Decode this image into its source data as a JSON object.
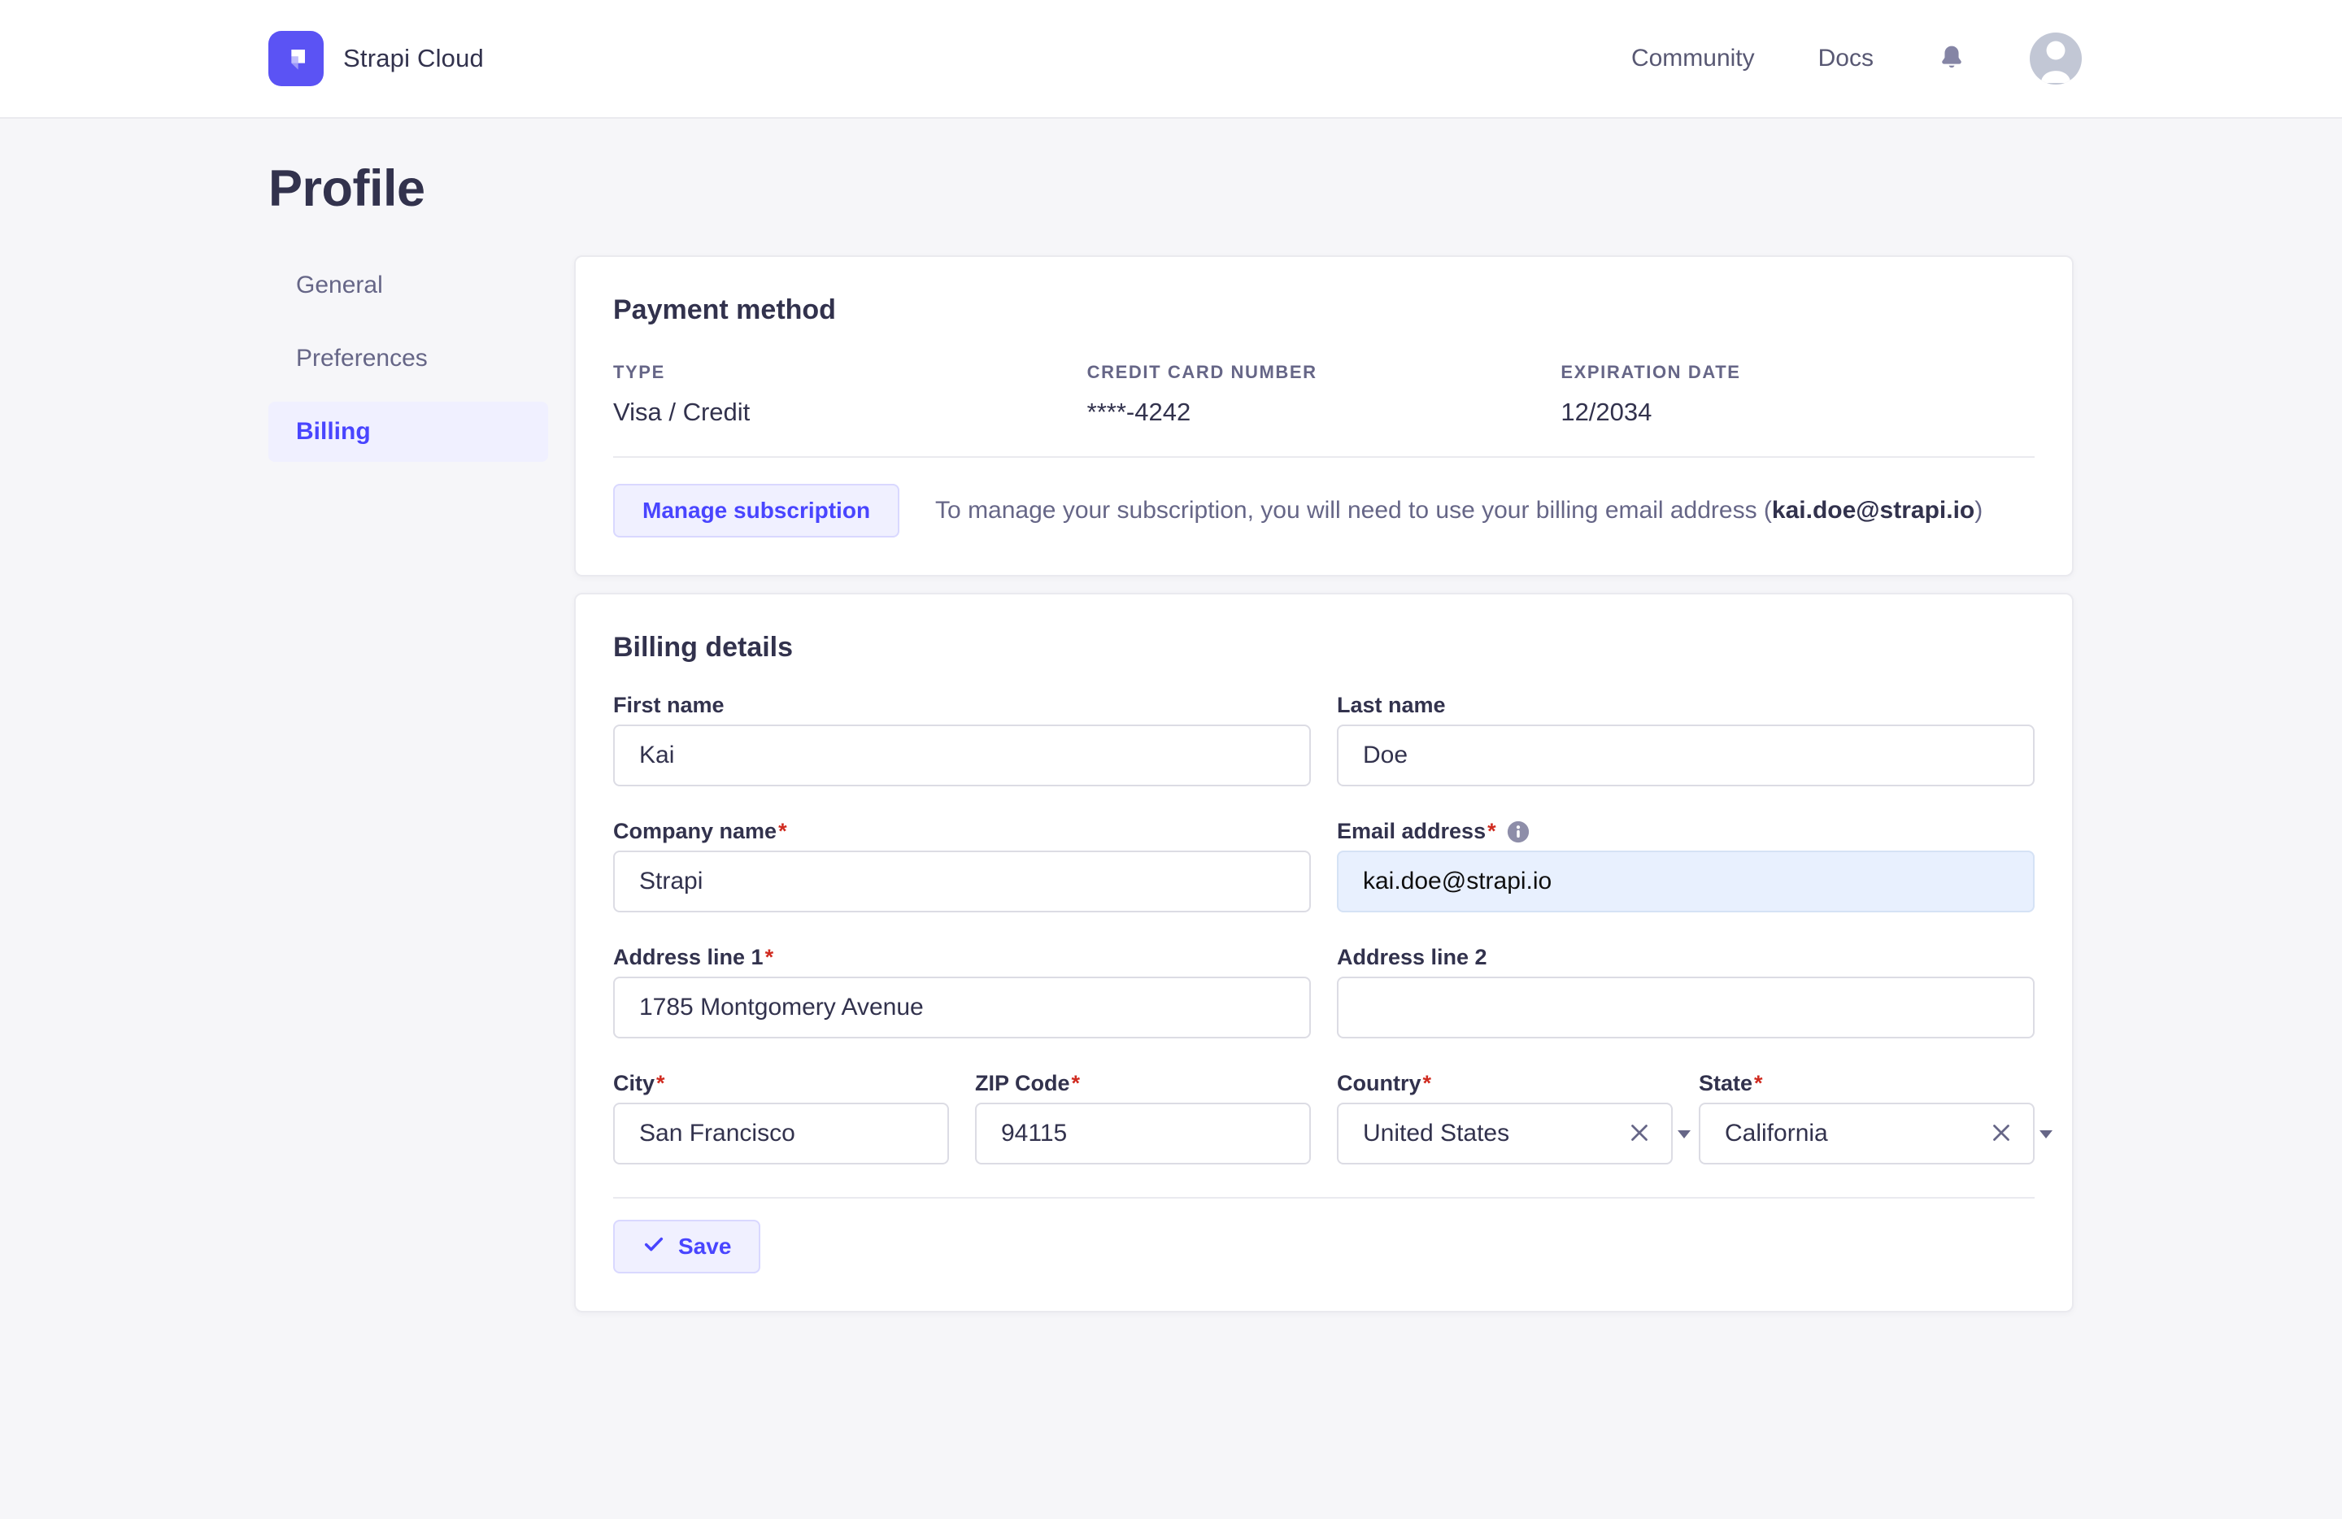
{
  "colors": {
    "accent": "#4945ff",
    "accent_bg": "#f0f0ff",
    "accent_border": "#d9d8ff",
    "page_bg": "#f6f6f9",
    "header_bg": "#ffffff",
    "text_dark": "#32324d",
    "text_muted": "#666687",
    "input_border": "#dcdce4",
    "divider": "#eaeaef",
    "required_marker_color": "#d02b20",
    "autofill_bg": "#e8f0fe",
    "logo_bg": "#5b53f4",
    "icon_muted": "#8e8ea9",
    "avatar_bg": "#c2c7d5"
  },
  "icons": {
    "logo": "strapi-logo",
    "notifications": "bell",
    "account": "user-avatar",
    "email_hint": "info-circle",
    "clear": "x-mark",
    "dropdown": "caret-down",
    "save": "check"
  },
  "header": {
    "brand": "Strapi Cloud",
    "nav": [
      {
        "label": "Community"
      },
      {
        "label": "Docs"
      }
    ]
  },
  "page": {
    "title": "Profile"
  },
  "sidebar": {
    "items": [
      {
        "label": "General",
        "active": false
      },
      {
        "label": "Preferences",
        "active": false
      },
      {
        "label": "Billing",
        "active": true
      }
    ]
  },
  "payment": {
    "title": "Payment method",
    "columns": [
      {
        "label": "TYPE",
        "value": "Visa / Credit"
      },
      {
        "label": "CREDIT CARD NUMBER",
        "value": "****-4242"
      },
      {
        "label": "EXPIRATION DATE",
        "value": "12/2034"
      }
    ],
    "manage_button": "Manage subscription",
    "note_prefix": "To manage your subscription, you will need to use your billing email address (",
    "note_email": "kai.doe@strapi.io",
    "note_suffix": ")"
  },
  "billing": {
    "title": "Billing details",
    "required_marker": "*",
    "fields": {
      "first_name": {
        "label": "First name",
        "value": "Kai",
        "required": false
      },
      "last_name": {
        "label": "Last name",
        "value": "Doe",
        "required": false
      },
      "company": {
        "label": "Company name",
        "value": "Strapi",
        "required": true
      },
      "email": {
        "label": "Email address",
        "value": "kai.doe@strapi.io",
        "required": true
      },
      "address1": {
        "label": "Address line 1",
        "value": "1785 Montgomery Avenue",
        "required": true
      },
      "address2": {
        "label": "Address line 2",
        "value": "",
        "required": false
      },
      "city": {
        "label": "City",
        "value": "San Francisco",
        "required": true
      },
      "zip": {
        "label": "ZIP Code",
        "value": "94115",
        "required": true
      },
      "country": {
        "label": "Country",
        "value": "United States",
        "required": true
      },
      "state": {
        "label": "State",
        "value": "California",
        "required": true
      }
    },
    "save_button": "Save"
  }
}
